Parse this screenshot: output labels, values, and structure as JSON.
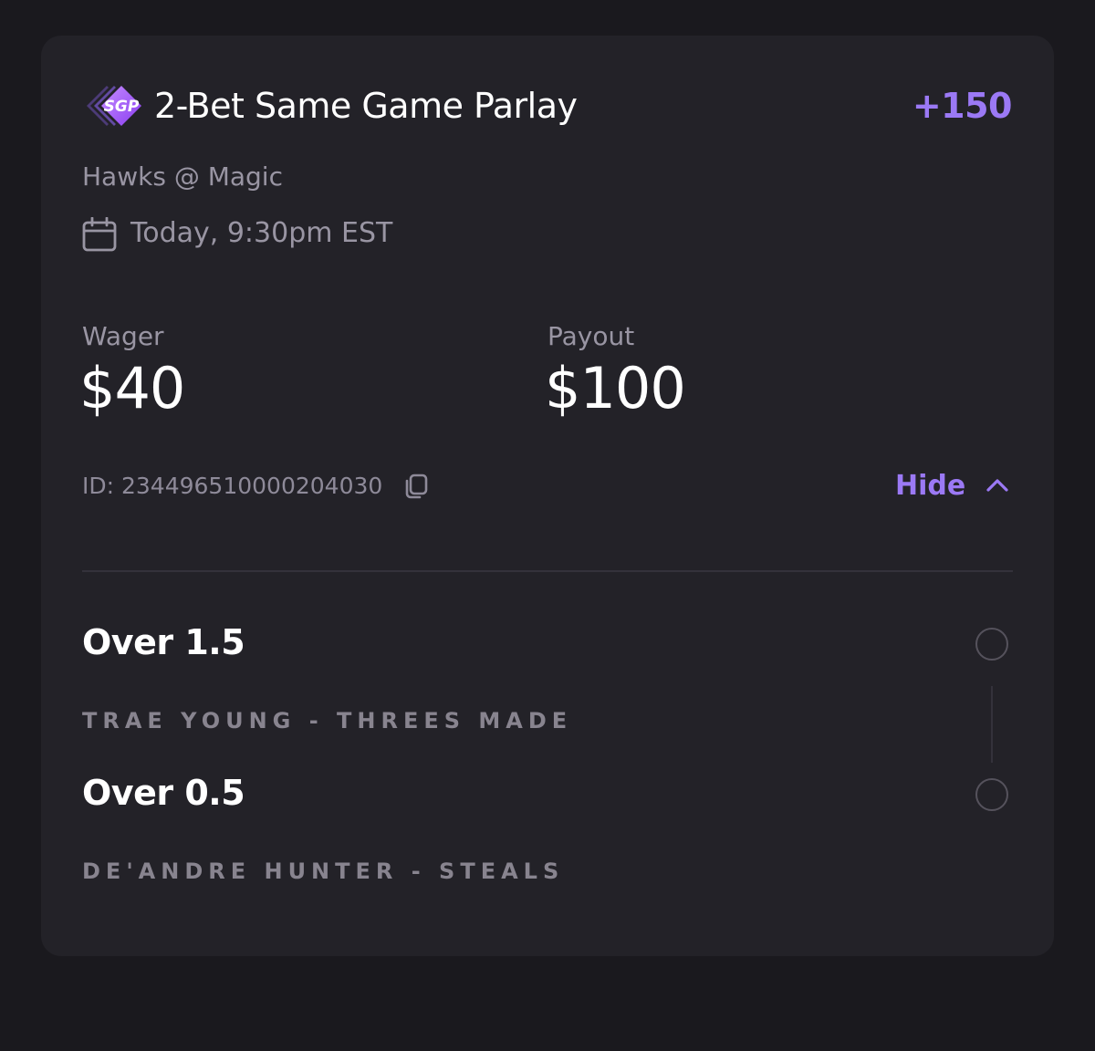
{
  "header": {
    "badge_text": "SGP",
    "title": "2-Bet Same Game Parlay",
    "odds": "+150"
  },
  "event": {
    "matchup": "Hawks @ Magic",
    "datetime": "Today, 9:30pm EST"
  },
  "wager": {
    "label": "Wager",
    "value": "$40"
  },
  "payout": {
    "label": "Payout",
    "value": "$100"
  },
  "bet_id": "ID: 234496510000204030",
  "toggle": {
    "label": "Hide"
  },
  "legs": [
    {
      "line": "Over 1.5",
      "description": "TRAE YOUNG - THREES MADE"
    },
    {
      "line": "Over 0.5",
      "description": "DE'ANDRE HUNTER - STEALS"
    }
  ],
  "colors": {
    "accent": "#9b79f5",
    "background": "#1a191e",
    "card": "#232228",
    "muted_text": "#9995a3"
  },
  "icons": [
    "sgp-logo-icon",
    "calendar-icon",
    "copy-icon",
    "chevron-up-icon"
  ]
}
